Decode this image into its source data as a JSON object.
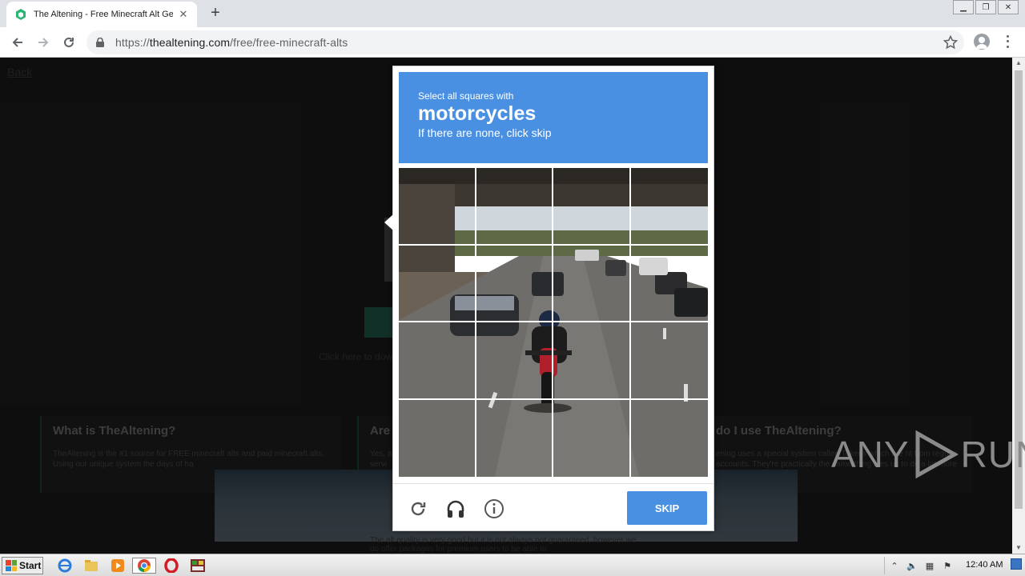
{
  "browser": {
    "tab_title": "The Altening - Free Minecraft Alt Gen",
    "url_scheme": "https://",
    "url_host": "thealtening.com",
    "url_path": "/free/free-minecraft-alts"
  },
  "page": {
    "back_link": "Back",
    "click_hint": "Click here to dow",
    "cards": [
      {
        "title": "What is TheAltening?",
        "text": "TheAltening is the #1 source for FREE minecraft alts and paid minecraft alts. Using our unique system the days of ha"
      },
      {
        "title": "Are",
        "text": "Yes, a servi"
      },
      {
        "title": "do I use TheAltening?",
        "text": "ening uses a special system called Tokens which are nt from regular accounts. They're practically the same thing bles us to do a lot more cool things!..."
      }
    ],
    "bottom_text": "The alt quality is very good but it is not always not guaranteed, however we do offer packages for premium users to be able to"
  },
  "watermark": {
    "left": "ANY",
    "right": "RUN"
  },
  "captcha": {
    "instruction": "Select all squares with",
    "keyword": "motorcycles",
    "subtext": "If there are none, click skip",
    "skip_label": "SKIP",
    "grid_rows": 4,
    "grid_cols": 4,
    "header_color": "#4a90e2"
  },
  "taskbar": {
    "start_label": "Start",
    "clock": "12:40 AM"
  }
}
